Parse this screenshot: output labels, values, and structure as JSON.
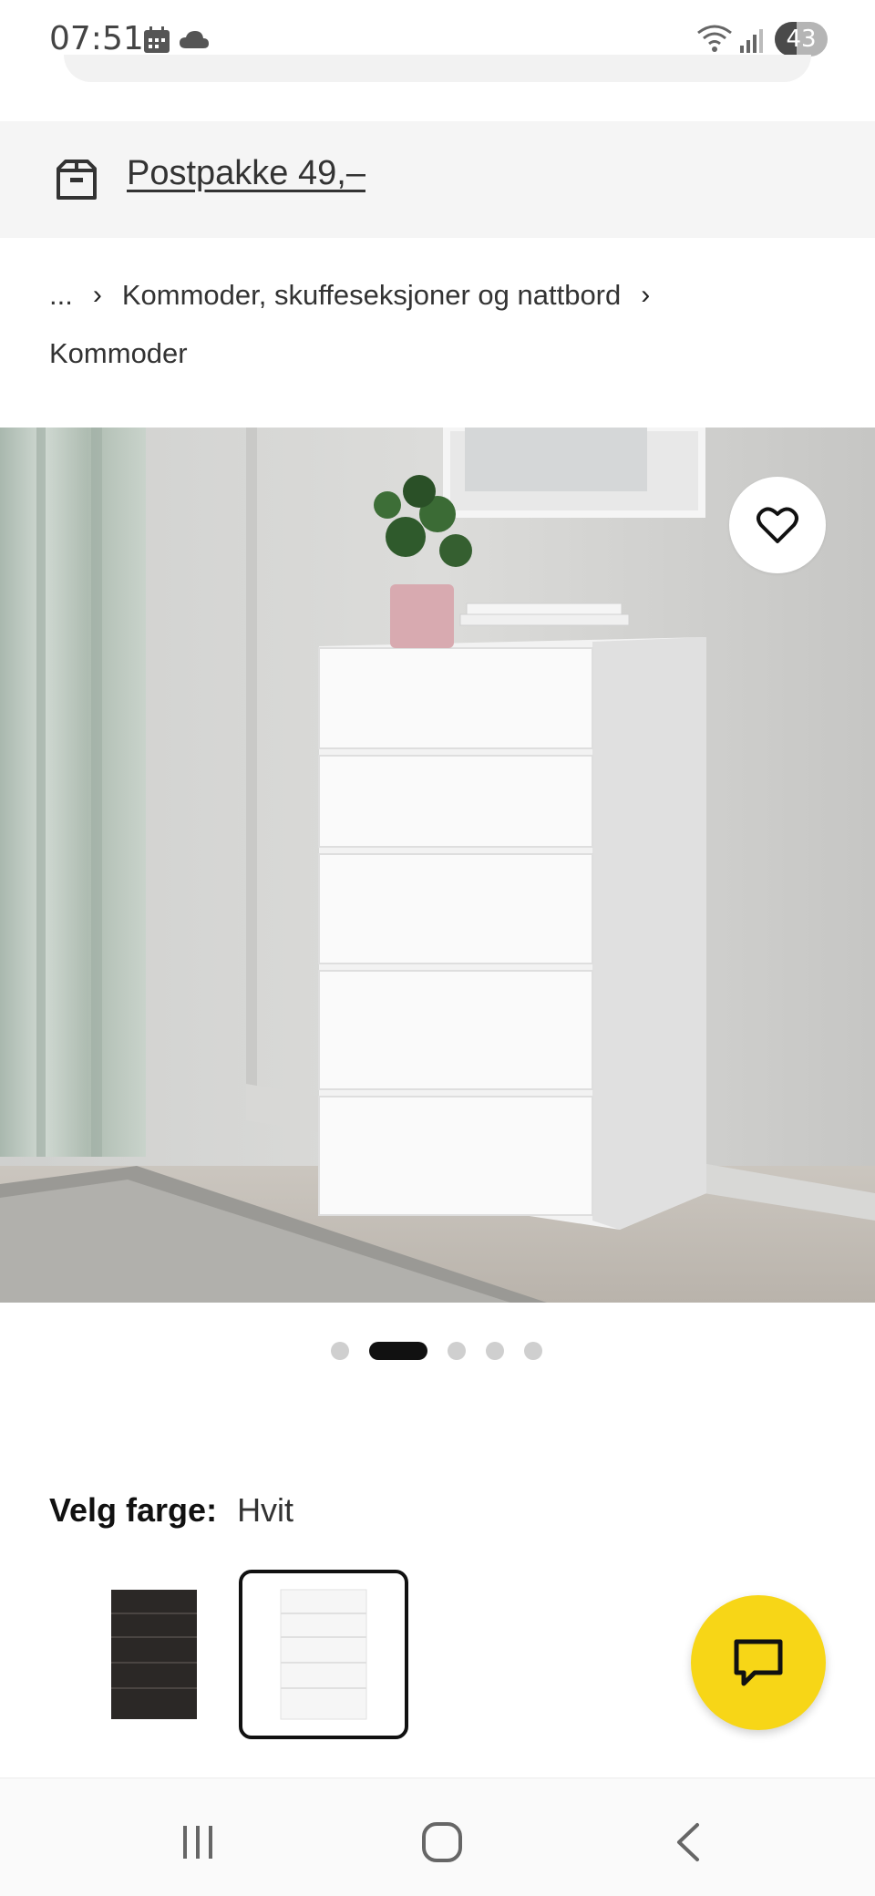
{
  "status_bar": {
    "time": "07:51",
    "battery_level": "43",
    "icons": [
      "calendar-icon",
      "cloud-icon",
      "wifi-icon",
      "signal-icon",
      "battery-icon"
    ]
  },
  "shipping": {
    "icon": "parcel-icon",
    "label": "Postpakke 49,–"
  },
  "breadcrumb": {
    "ellipsis": "...",
    "items": [
      "Kommoder, skuffeseksjoner og nattbord",
      "Kommoder"
    ]
  },
  "gallery": {
    "image_description": "White chest of 5 drawers with plant",
    "favourite_icon": "heart-outline-icon",
    "total_images": 5,
    "active_image": 2
  },
  "color_chooser": {
    "label": "Velg farge:",
    "value": "Hvit",
    "options": [
      {
        "name": "Black-brown",
        "color": "#2b2826",
        "selected": false
      },
      {
        "name": "Hvit",
        "color": "#f4f4f4",
        "selected": true
      }
    ]
  },
  "chat": {
    "icon": "chat-bubble-icon",
    "color": "#f7d617"
  },
  "nav_bar": {
    "buttons": [
      "recent-apps-icon",
      "home-icon",
      "back-icon"
    ]
  },
  "colors": {
    "accent_yellow": "#f7d617",
    "text": "#111111",
    "band_bg": "#f5f5f5"
  }
}
